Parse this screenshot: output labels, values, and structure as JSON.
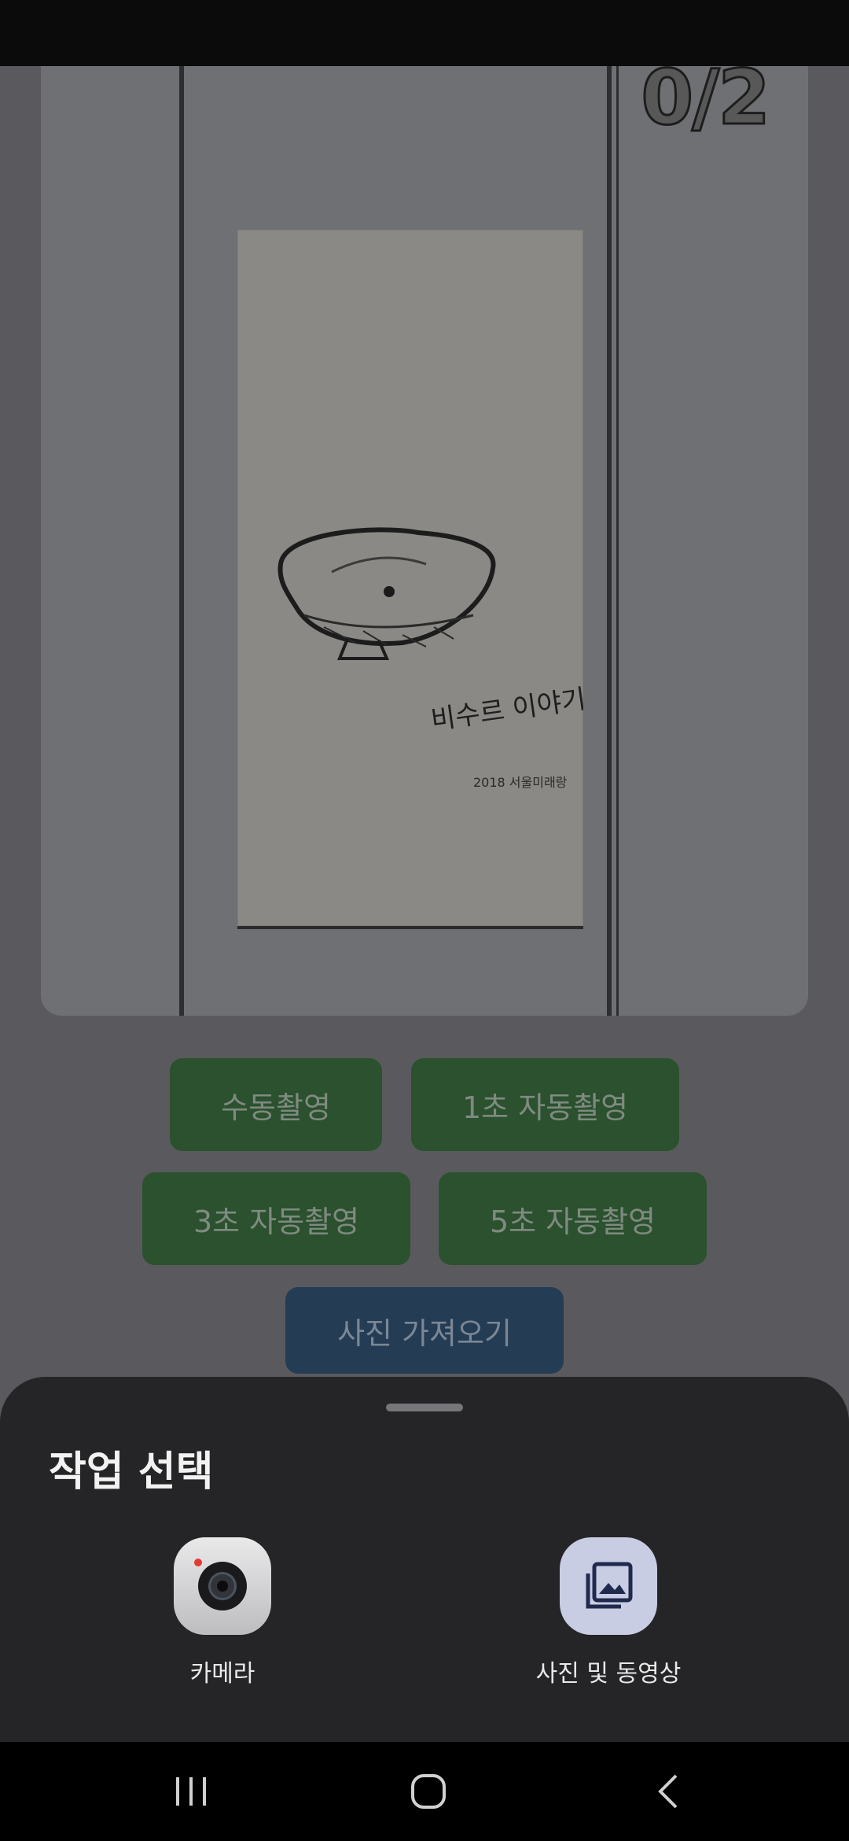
{
  "preview": {
    "counter": "0/2",
    "drawing_text": "비수르 이야기",
    "drawing_signature": "2018 서울미래랑"
  },
  "buttons": {
    "manual": "수동촬영",
    "auto_1s": "1초 자동촬영",
    "auto_3s": "3초 자동촬영",
    "auto_5s": "5초 자동촬영",
    "import_photo": "사진 가져오기"
  },
  "sheet": {
    "title": "작업 선택",
    "options": [
      {
        "label": "카메라",
        "icon": "camera-icon"
      },
      {
        "label": "사진 및 동영상",
        "icon": "gallery-icon"
      }
    ]
  },
  "nav": {
    "recent_icon": "recent-apps-icon",
    "home_icon": "home-icon",
    "back_icon": "back-icon"
  },
  "colors": {
    "green_button": "#2b512f",
    "blue_button": "#253c55",
    "sheet_bg": "#252527"
  }
}
